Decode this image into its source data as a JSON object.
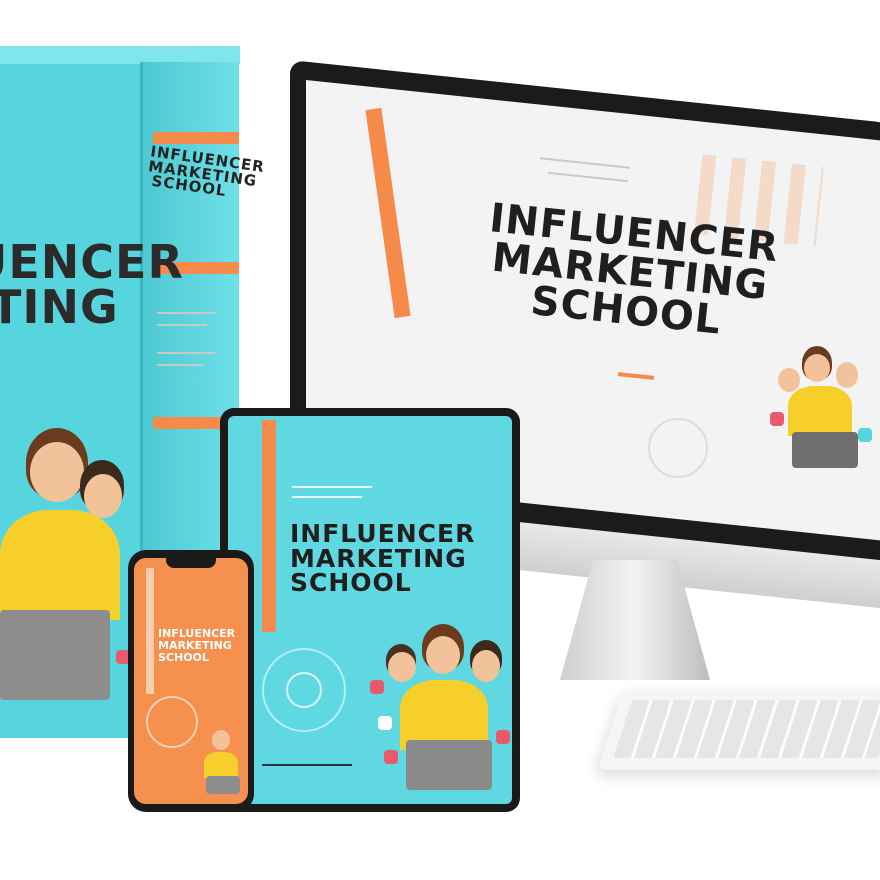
{
  "product": {
    "title_line1": "INFLUENCER",
    "title_line2": "MARKETING",
    "title_line3": "SCHOOL",
    "box_title_partial_line1": "UENCER",
    "box_title_partial_line2": "TING"
  },
  "colors": {
    "turquoise": "#56d5de",
    "orange": "#f58a4b",
    "dark_text": "#1f1f1f",
    "device_black": "#1a1a1a",
    "screen_white": "#f3f3f3"
  },
  "icons": [
    "user-circle-icon",
    "like-bubble-icon",
    "heart-bubble-icon",
    "laptop-icon"
  ]
}
